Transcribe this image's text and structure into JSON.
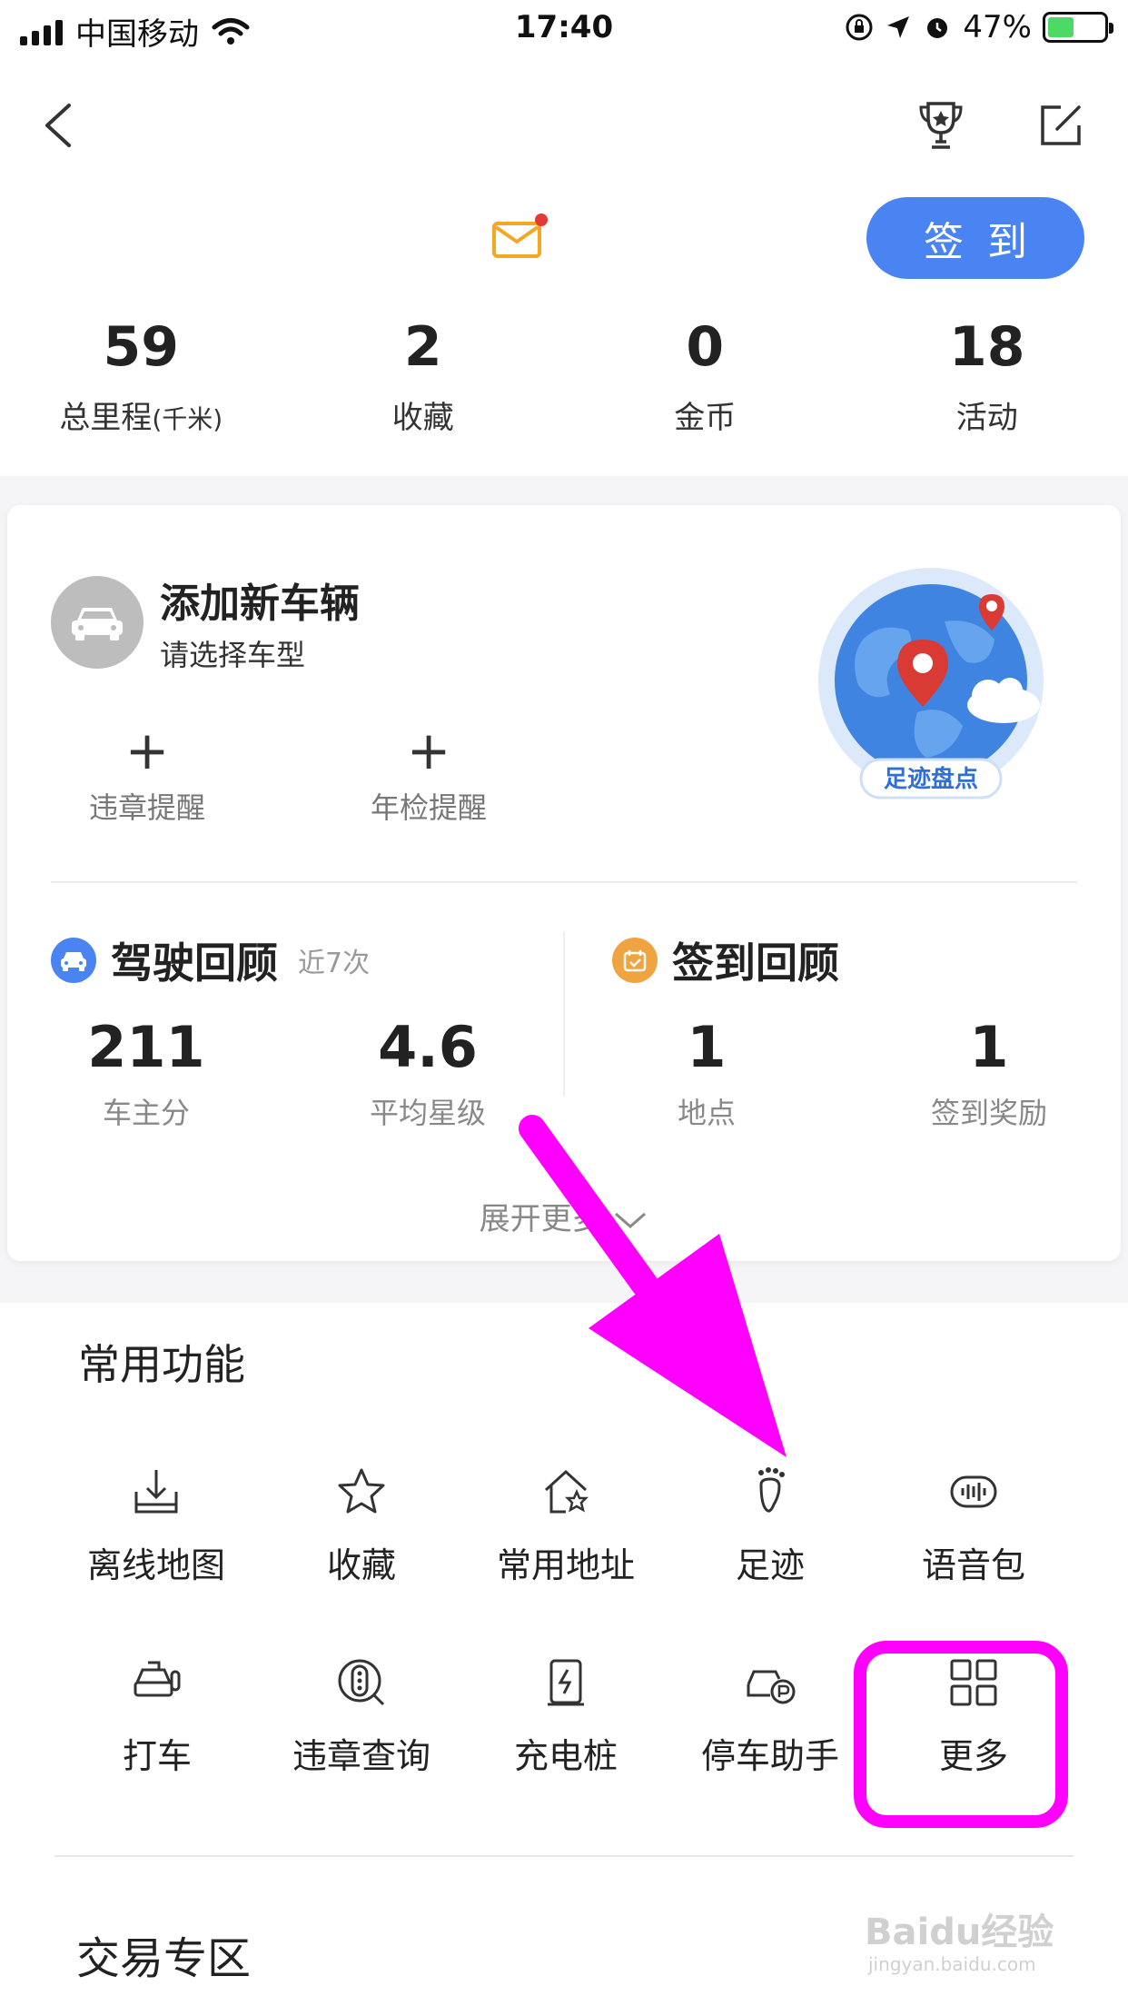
{
  "status_bar": {
    "carrier": "中国移动",
    "time": "17:40",
    "battery": "47%",
    "battery_level": 0.47
  },
  "nav": {
    "back_icon": "chevron-left-icon",
    "trophy_icon": "trophy-icon",
    "edit_icon": "edit-icon"
  },
  "header": {
    "mail_icon": "mail-icon",
    "checkin_label": "签到"
  },
  "stats": [
    {
      "value": "59",
      "label": "总里程",
      "unit": "(千米)"
    },
    {
      "value": "2",
      "label": "收藏"
    },
    {
      "value": "0",
      "label": "金币"
    },
    {
      "value": "18",
      "label": "活动"
    }
  ],
  "vehicle": {
    "title": "添加新车辆",
    "subtitle": "请选择车型",
    "reminders": [
      "违章提醒",
      "年检提醒"
    ],
    "footprint_badge": "足迹盘点"
  },
  "driving_review": {
    "title": "驾驶回顾",
    "subtitle": "近7次",
    "metrics": [
      {
        "value": "211",
        "label": "车主分"
      },
      {
        "value": "4.6",
        "label": "平均星级"
      }
    ]
  },
  "checkin_review": {
    "title": "签到回顾",
    "metrics": [
      {
        "value": "1",
        "label": "地点"
      },
      {
        "value": "1",
        "label": "签到奖励"
      }
    ]
  },
  "expand_label": "展开更多",
  "functions": {
    "title": "常用功能",
    "items": [
      {
        "label": "离线地图",
        "icon": "offline-map-icon"
      },
      {
        "label": "收藏",
        "icon": "star-icon"
      },
      {
        "label": "常用地址",
        "icon": "home-star-icon"
      },
      {
        "label": "足迹",
        "icon": "footprint-icon"
      },
      {
        "label": "语音包",
        "icon": "voice-pack-icon"
      },
      {
        "label": "打车",
        "icon": "taxi-icon"
      },
      {
        "label": "违章查询",
        "icon": "violation-query-icon"
      },
      {
        "label": "充电桩",
        "icon": "charging-pile-icon"
      },
      {
        "label": "停车助手",
        "icon": "parking-icon"
      },
      {
        "label": "更多",
        "icon": "grid-more-icon"
      }
    ]
  },
  "trade": {
    "title": "交易专区"
  },
  "watermark": {
    "text": "Baidu经验",
    "url": "jingyan.baidu.com"
  },
  "colors": {
    "accent": "#4a84f3",
    "highlight": "#ff00ff",
    "mail": "#f5a623"
  }
}
